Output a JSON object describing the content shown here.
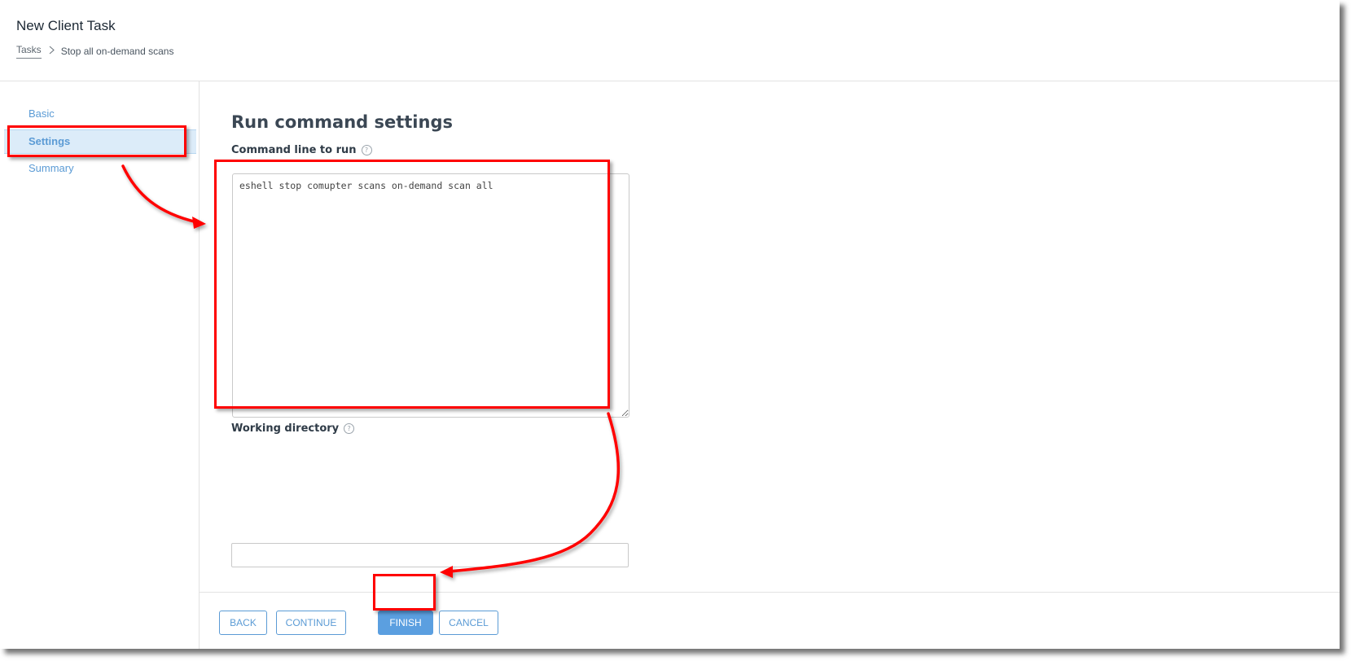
{
  "header": {
    "title": "New Client Task",
    "breadcrumb": {
      "link": "Tasks",
      "separator_icon": "chevron-right-icon",
      "current": "Stop all on-demand scans"
    }
  },
  "sidebar": {
    "items": [
      {
        "label": "Basic",
        "active": false
      },
      {
        "label": "Settings",
        "active": true
      },
      {
        "label": "Summary",
        "active": false
      }
    ]
  },
  "main": {
    "section_title": "Run command settings",
    "command_line": {
      "label": "Command line to run",
      "help_icon": "question-circle-icon",
      "value": "eshell stop comupter scans on-demand scan all"
    },
    "working_directory": {
      "label": "Working directory",
      "help_icon": "question-circle-icon",
      "value": ""
    }
  },
  "footer": {
    "back_label": "BACK",
    "continue_label": "CONTINUE",
    "finish_label": "FINISH",
    "cancel_label": "CANCEL"
  },
  "annotations": {
    "highlight_color": "#ff0000",
    "accent_color": "#5b9bd5"
  }
}
